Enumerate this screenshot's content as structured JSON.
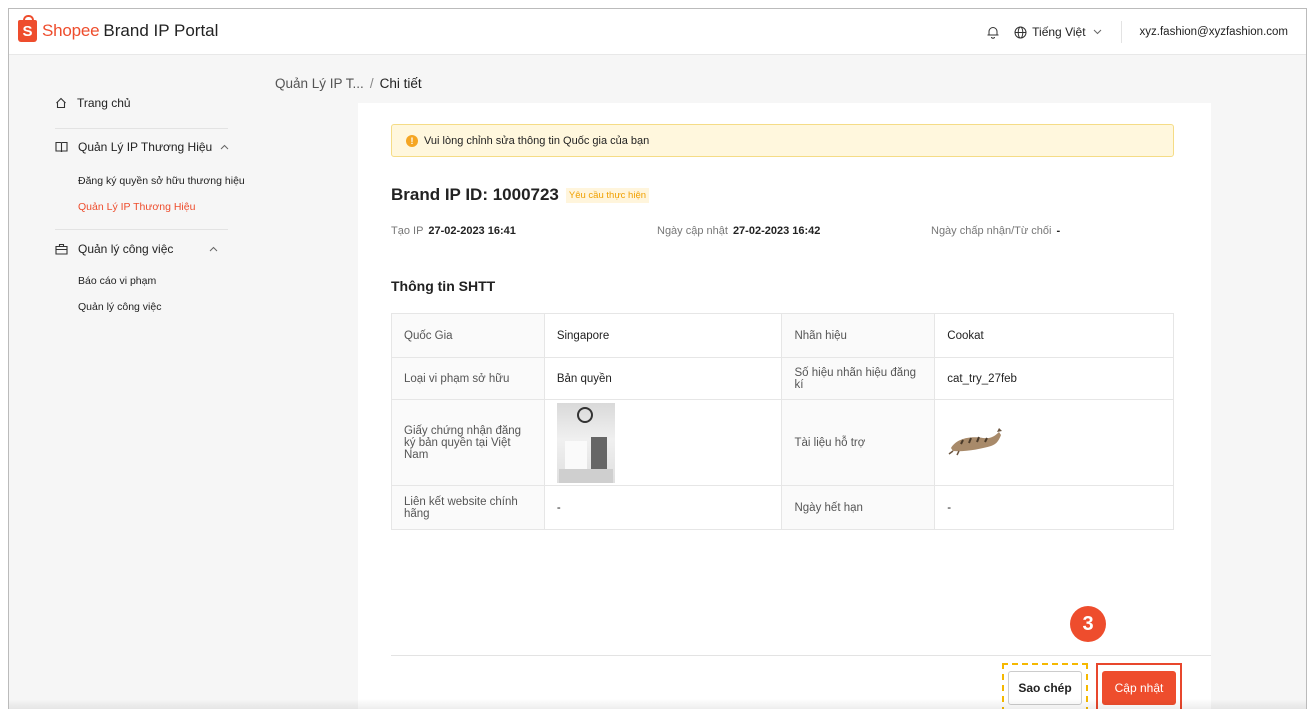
{
  "header": {
    "logo_brand": "Shopee",
    "logo_suffix": "Brand IP Portal",
    "logo_mark": "S",
    "language": "Tiếng Việt",
    "user_email": "xyz.fashion@xyzfashion.com",
    "icons": [
      "bell-icon",
      "globe-icon",
      "chevron-down-icon"
    ]
  },
  "sidebar": {
    "home": "Trang chủ",
    "brand_ip_group": "Quản Lý IP Thương Hiệu",
    "brand_ip_items": [
      "Đăng ký quyền sở hữu thương hiệu",
      "Quản Lý IP Thương Hiệu"
    ],
    "work_group": "Quản lý công việc",
    "work_items": [
      "Báo cáo vi phạm",
      "Quản lý công việc"
    ]
  },
  "breadcrumb": {
    "parent": "Quản Lý IP T...",
    "separator": "/",
    "current": "Chi tiết"
  },
  "detail": {
    "alert": "Vui lòng chỉnh sửa thông tin Quốc gia của bạn",
    "alert_icon": "!",
    "brand_id_label": "Brand IP ID: 1000723",
    "status": "Yêu cầu thực hiện",
    "created_label": "Tạo IP",
    "created_value": "27-02-2023 16:41",
    "updated_label": "Ngày cập nhật",
    "updated_value": "27-02-2023 16:42",
    "decision_label": "Ngày chấp nhận/Từ chối",
    "decision_value": "-",
    "section_title": "Thông tin SHTT",
    "table": {
      "country_label": "Quốc Gia",
      "country_value": "Singapore",
      "trademark_label": "Nhãn hiệu",
      "trademark_value": "Cookat",
      "violation_label": "Loại vi phạm sở hữu",
      "violation_value": "Bản quyền",
      "reg_no_label": "Số hiệu nhãn hiệu đăng kí",
      "reg_no_value": "cat_try_27feb",
      "certificate_label": "Giấy chứng nhận đăng ký bản quyền tại Việt Nam",
      "support_doc_label": "Tài liệu hỗ trợ",
      "website_label": "Liên kết website chính hãng",
      "website_value": "-",
      "expiry_label": "Ngày hết hạn",
      "expiry_value": "-"
    },
    "copy_button": "Sao chép",
    "update_button": "Cập nhật",
    "step_number": "3"
  },
  "colors": {
    "brand": "#ee4d2d",
    "alert_bg": "#fff7dd",
    "highlight_dash": "#f5b800"
  }
}
